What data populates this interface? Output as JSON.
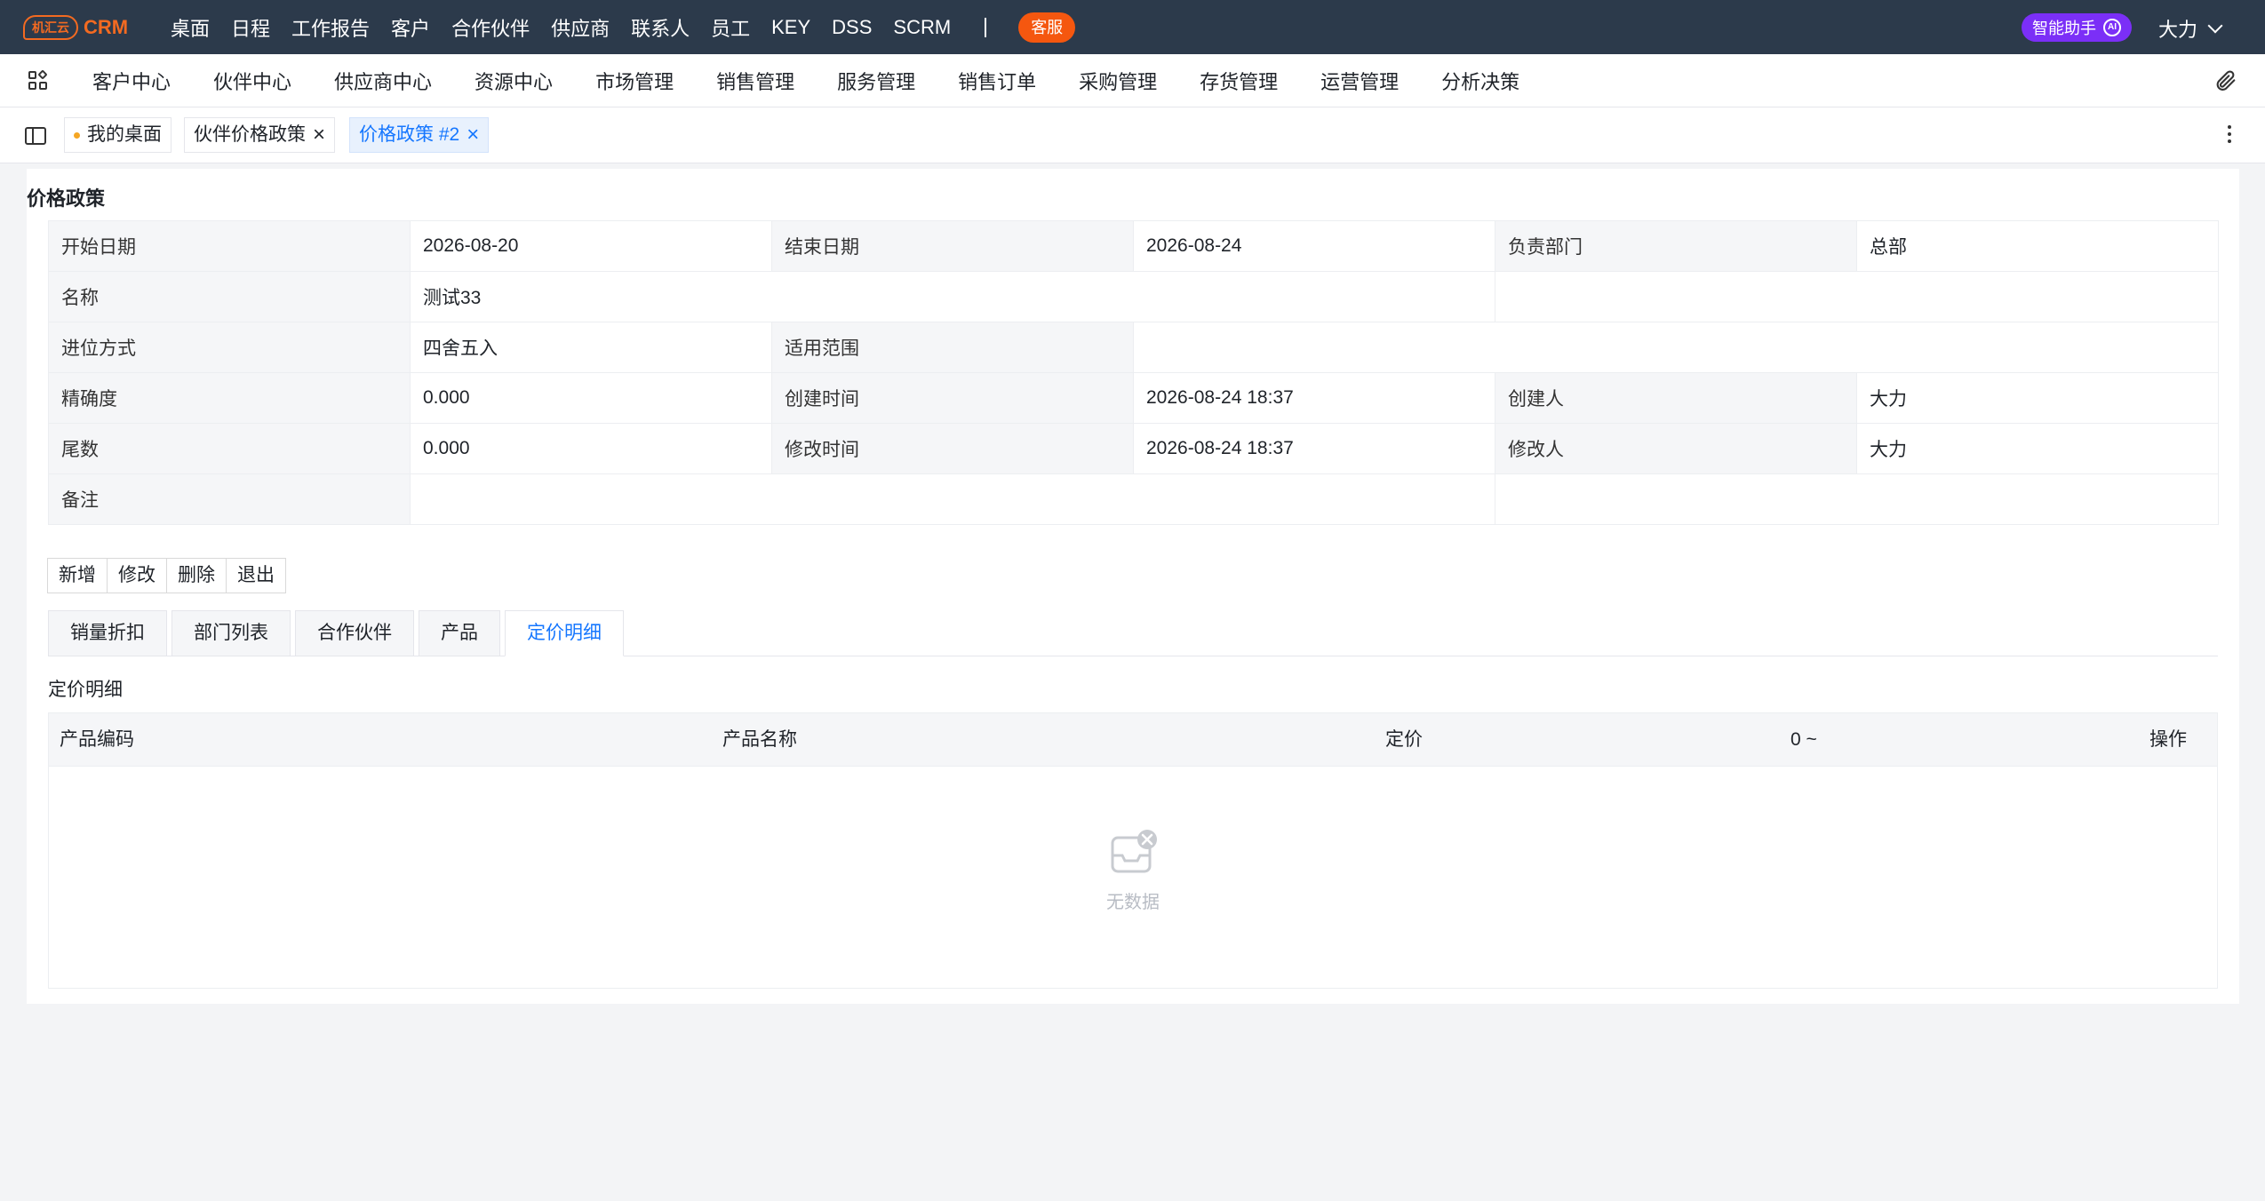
{
  "app": {
    "logo_badge": "机汇云",
    "logo_text": "CRM"
  },
  "topnav": {
    "items": [
      "桌面",
      "日程",
      "工作报告",
      "客户",
      "合作伙伴",
      "供应商",
      "联系人",
      "员工",
      "KEY",
      "DSS",
      "SCRM"
    ],
    "kefu": "客服",
    "assistant": "智能助手",
    "assistant_badge": "AI",
    "user": "大力"
  },
  "modules": [
    "客户中心",
    "伙伴中心",
    "供应商中心",
    "资源中心",
    "市场管理",
    "销售管理",
    "服务管理",
    "销售订单",
    "采购管理",
    "存货管理",
    "运营管理",
    "分析决策"
  ],
  "tabs": [
    {
      "label": "我的桌面",
      "closable": false
    },
    {
      "label": "伙伴价格政策",
      "closable": true
    },
    {
      "label": "价格政策 #2",
      "closable": true,
      "active": true
    }
  ],
  "page": {
    "title": "价格政策"
  },
  "info": {
    "start_date_label": "开始日期",
    "start_date": "2026-08-20",
    "end_date_label": "结束日期",
    "end_date": "2026-08-24",
    "dept_label": "负责部门",
    "dept": "总部",
    "name_label": "名称",
    "name": "测试33",
    "rounding_label": "进位方式",
    "rounding": "四舍五入",
    "scope_label": "适用范围",
    "scope": "",
    "precision_label": "精确度",
    "precision": "0.000",
    "created_time_label": "创建时间",
    "created_time": "2026-08-24 18:37",
    "creator_label": "创建人",
    "creator": "大力",
    "tail_label": "尾数",
    "tail": "0.000",
    "modified_time_label": "修改时间",
    "modified_time": "2026-08-24 18:37",
    "modifier_label": "修改人",
    "modifier": "大力",
    "remark_label": "备注",
    "remark": ""
  },
  "actions": [
    "新增",
    "修改",
    "删除",
    "退出"
  ],
  "subtabs": [
    "销量折扣",
    "部门列表",
    "合作伙伴",
    "产品",
    "定价明细"
  ],
  "active_subtab": "定价明细",
  "detail": {
    "title": "定价明细",
    "columns": [
      "产品编码",
      "产品名称",
      "定价",
      "0 ~",
      "操作"
    ],
    "empty_text": "无数据"
  },
  "colors": {
    "topbar": "#2c3a4b",
    "brand": "#f36a21",
    "kefu": "#f5570f",
    "assistant": "#7b2ff7",
    "accent": "#1677ff"
  }
}
